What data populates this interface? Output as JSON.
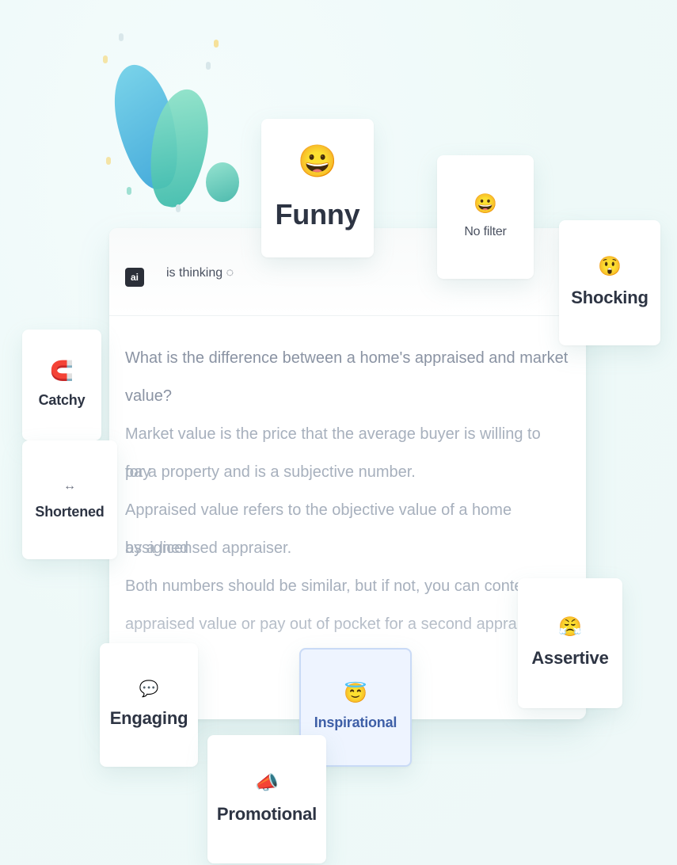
{
  "chat": {
    "avatar_label": "ai",
    "status": "is thinking ◌",
    "question": "What is the difference between a home's appraised and market value?",
    "answer_lines": [
      "Market value is the price that the average buyer is willing to pay",
      "for a property and is a subjective number.",
      "Appraised value refers to the objective value of a home assigned",
      "by a licensed appraiser.",
      "Both numbers should be similar, but if not, you can contest",
      "appraised value or pay out of pocket for a second appraisal."
    ]
  },
  "tones": {
    "funny": {
      "emoji": "😀",
      "label": "Funny"
    },
    "no_filter": {
      "emoji": "😀",
      "label": "No filter"
    },
    "shocking": {
      "emoji": "😲",
      "label": "Shocking"
    },
    "catchy": {
      "emoji": "🧲",
      "label": "Catchy"
    },
    "shortened": {
      "emoji": "↔",
      "label": "Shortened"
    },
    "engaging": {
      "emoji": "💬",
      "label": "Engaging"
    },
    "inspirational": {
      "emoji": "😇",
      "label": "Inspirational",
      "selected": true
    },
    "assertive": {
      "emoji": "😤",
      "label": "Assertive"
    },
    "promotional": {
      "emoji": "📣",
      "label": "Promotional"
    }
  },
  "colors": {
    "background": "#f0fafa",
    "balloon_blue": "#2f9fd6",
    "balloon_teal": "#38b9a9",
    "selected_chip_bg": "#eef4ff",
    "emoji_yellow": "#e2a93a",
    "catchy_red": "#c4273a"
  }
}
